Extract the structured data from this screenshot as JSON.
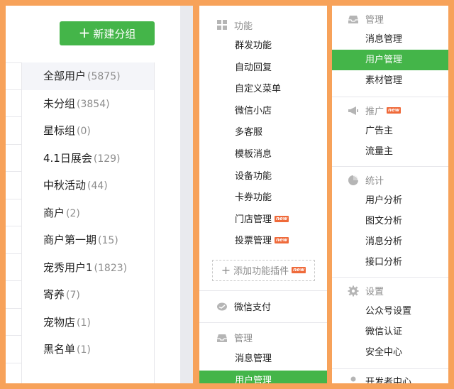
{
  "groups_panel": {
    "new_group_button": "新建分组",
    "groups": [
      {
        "name": "全部用户",
        "count": "(5875)"
      },
      {
        "name": "未分组",
        "count": "(3854)"
      },
      {
        "name": "星标组",
        "count": "(0)"
      },
      {
        "name": "4.1日展会",
        "count": "(129)"
      },
      {
        "name": "中秋活动",
        "count": "(44)"
      },
      {
        "name": "商户",
        "count": "(2)"
      },
      {
        "name": "商户第一期",
        "count": "(15)"
      },
      {
        "name": "宠秀用户1",
        "count": "(1823)"
      },
      {
        "name": "寄养",
        "count": "(7)"
      },
      {
        "name": "宠物店",
        "count": "(1)"
      },
      {
        "name": "黑名单",
        "count": "(1)"
      }
    ]
  },
  "features_panel": {
    "section_title": "功能",
    "items": [
      "群发功能",
      "自动回复",
      "自定义菜单",
      "微信小店",
      "多客服",
      "模板消息",
      "设备功能",
      "卡券功能",
      "门店管理",
      "投票管理"
    ],
    "new_tag": "new",
    "add_plugin": "添加功能插件",
    "wechat_pay": "微信支付",
    "manage_title": "管理",
    "manage_items": [
      "消息管理",
      "用户管理"
    ]
  },
  "manage_panel": {
    "manage": {
      "title": "管理",
      "items": [
        "消息管理",
        "用户管理",
        "素材管理"
      ]
    },
    "promote": {
      "title": "推广",
      "items": [
        "广告主",
        "流量主"
      ]
    },
    "stats": {
      "title": "统计",
      "items": [
        "用户分析",
        "图文分析",
        "消息分析",
        "接口分析"
      ]
    },
    "settings": {
      "title": "设置",
      "items": [
        "公众号设置",
        "微信认证",
        "安全中心"
      ]
    },
    "developer": {
      "title": "开发者中心"
    }
  },
  "colors": {
    "accent": "#44b549",
    "frame": "#f7a25a",
    "new_tag": "#ef6a3a"
  },
  "icons": [
    "grid-icon",
    "inbox-icon",
    "megaphone-icon",
    "pie-chart-icon",
    "gear-icon",
    "chat-bubble-icon",
    "person-icon"
  ]
}
